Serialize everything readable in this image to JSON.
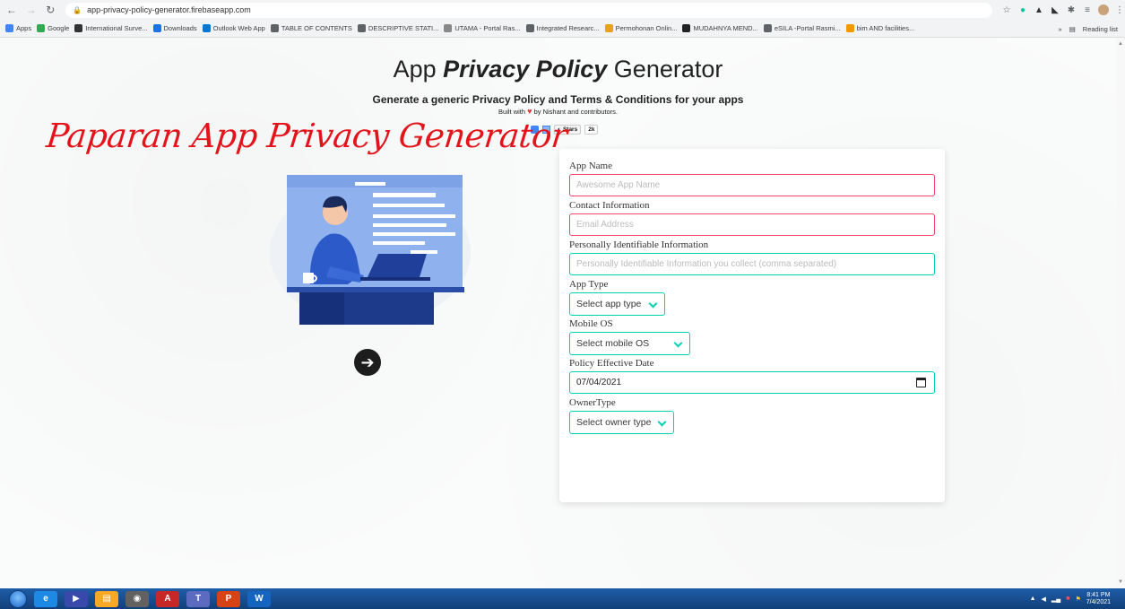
{
  "browser": {
    "url": "app-privacy-policy-generator.firebaseapp.com",
    "bookmarks": [
      {
        "label": "Apps",
        "color": "#4285f4"
      },
      {
        "label": "Google",
        "color": "#34a853"
      },
      {
        "label": "International Surve...",
        "color": "#333333"
      },
      {
        "label": "Downloads",
        "color": "#1a73e8"
      },
      {
        "label": "Outlook Web App",
        "color": "#0078d4"
      },
      {
        "label": "TABLE OF CONTENTS",
        "color": "#5f6368"
      },
      {
        "label": "DESCRIPTIVE STATI...",
        "color": "#5f6368"
      },
      {
        "label": "UTAMA - Portal Ras...",
        "color": "#888888"
      },
      {
        "label": "Integrated Researc...",
        "color": "#5f6368"
      },
      {
        "label": "Permohonan Onlin...",
        "color": "#e8a317"
      },
      {
        "label": "MUDAHNYA MEND...",
        "color": "#222222"
      },
      {
        "label": "eSILA -Portal Rasmi...",
        "color": "#5f6368"
      },
      {
        "label": "bim AND facilities...",
        "color": "#f29900"
      }
    ],
    "more_label": "»",
    "reading_list": "Reading list"
  },
  "page": {
    "title_prefix": "App ",
    "title_emphasis": "Privacy Policy",
    "title_suffix": " Generator",
    "subtitle": "Generate a generic Privacy Policy and Terms & Conditions for your apps",
    "built_prefix": "Built with",
    "built_suffix": "by Nishant and contributors.",
    "github_stars_label": "Stars",
    "github_stars_count": "2k",
    "overlay_caption": "Paparan App Privacy Generator"
  },
  "form": {
    "app_name_label": "App Name",
    "app_name_placeholder": "Awesome App Name",
    "contact_label": "Contact Information",
    "contact_placeholder": "Email Address",
    "pii_label": "Personally Identifiable Information",
    "pii_placeholder": "Personally Identifiable Information you collect (comma separated)",
    "app_type_label": "App Type",
    "app_type_value": "Select app type",
    "mobile_os_label": "Mobile OS",
    "mobile_os_value": "Select mobile OS",
    "date_label": "Policy Effective Date",
    "date_value": "07/04/2021",
    "owner_label": "OwnerType",
    "owner_value": "Select owner type"
  },
  "taskbar": {
    "apps": [
      {
        "icon": "internet-explorer-icon",
        "label": "e",
        "color": "#1e88e5"
      },
      {
        "icon": "media-player-icon",
        "label": "▶",
        "color": "#3949ab"
      },
      {
        "icon": "explorer-icon",
        "label": "▤",
        "color": "#f9a825"
      },
      {
        "icon": "chrome-icon",
        "label": "◉",
        "color": "#616161"
      },
      {
        "icon": "acrobat-icon",
        "label": "A",
        "color": "#c62828"
      },
      {
        "icon": "teams-icon",
        "label": "T",
        "color": "#5c6bc0"
      },
      {
        "icon": "powerpoint-icon",
        "label": "P",
        "color": "#d84315"
      },
      {
        "icon": "word-icon",
        "label": "W",
        "color": "#1565c0"
      }
    ],
    "time": "8:41 PM",
    "date": "7/4/2021"
  }
}
